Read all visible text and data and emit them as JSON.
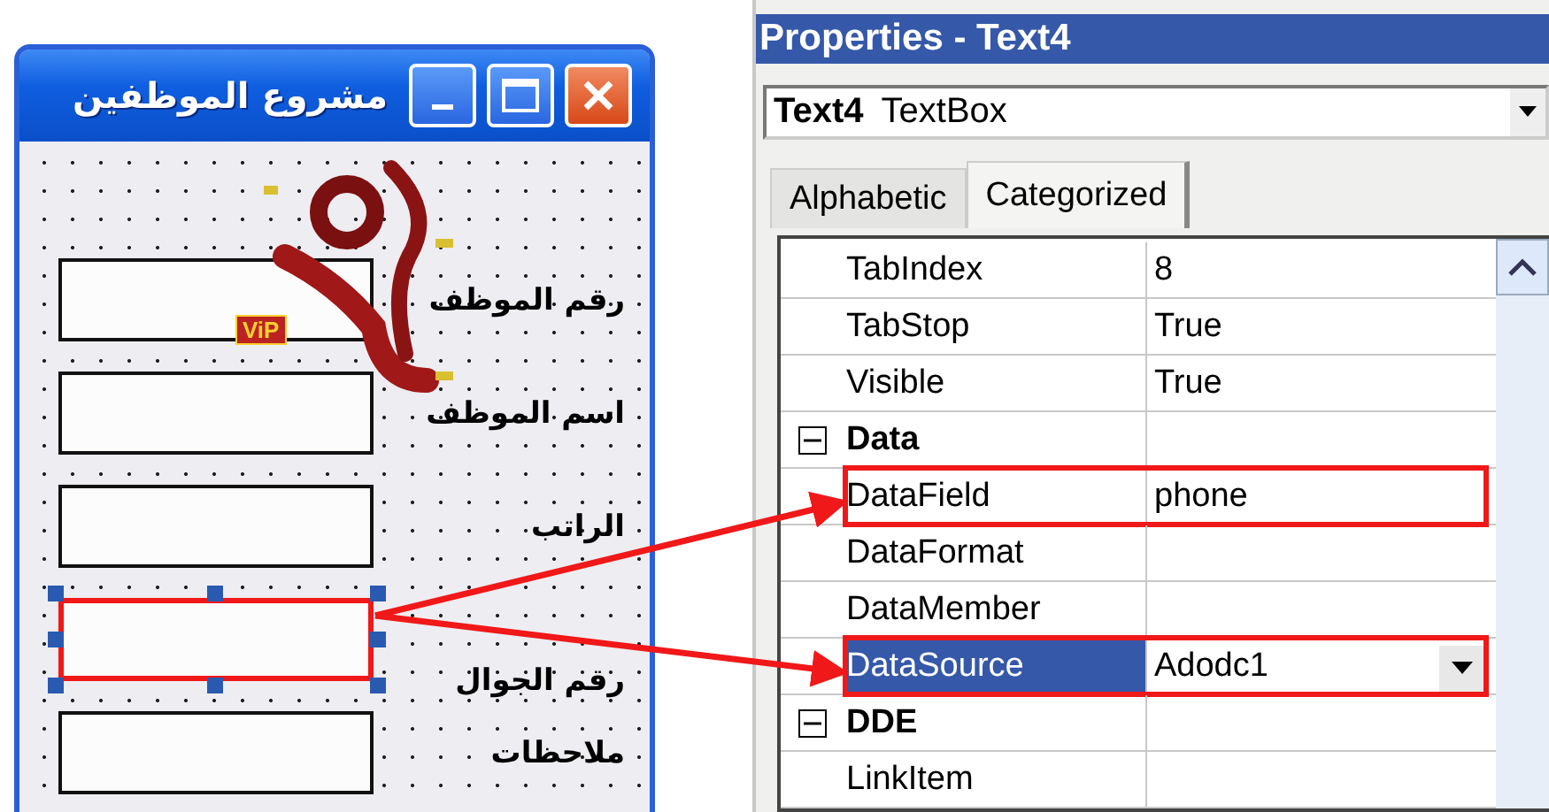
{
  "form": {
    "title": "مشروع الموظفين",
    "logo_badge": "ViP",
    "fields": [
      {
        "label": "رقم الموظف",
        "selected": false
      },
      {
        "label": "اسم الموظف",
        "selected": false
      },
      {
        "label": "الراتب",
        "selected": false
      },
      {
        "label": "رقم الجوال",
        "selected": true
      },
      {
        "label": "ملاحظات",
        "selected": false
      }
    ]
  },
  "properties": {
    "title": "Properties - Text4",
    "object_name": "Text4",
    "object_type": "TextBox",
    "tabs": [
      {
        "label": "Alphabetic",
        "selected": false
      },
      {
        "label": "Categorized",
        "selected": true
      }
    ],
    "rows": [
      {
        "kind": "property",
        "name": "TabIndex",
        "value": "8",
        "selected": false,
        "highlighted": false
      },
      {
        "kind": "property",
        "name": "TabStop",
        "value": "True",
        "selected": false,
        "highlighted": false
      },
      {
        "kind": "property",
        "name": "Visible",
        "value": "True",
        "selected": false,
        "highlighted": false
      },
      {
        "kind": "category",
        "name": "Data",
        "expanded": true
      },
      {
        "kind": "property",
        "name": "DataField",
        "value": "phone",
        "selected": false,
        "highlighted": true
      },
      {
        "kind": "property",
        "name": "DataFormat",
        "selected": false,
        "highlighted": false
      },
      {
        "kind": "property",
        "name": "DataMember",
        "selected": false,
        "highlighted": false
      },
      {
        "kind": "property",
        "name": "DataSource",
        "value": "Adodc1",
        "selected": true,
        "highlighted": true
      },
      {
        "kind": "category",
        "name": "DDE",
        "expanded": true
      },
      {
        "kind": "property",
        "name": "LinkItem",
        "selected": false,
        "highlighted": false
      }
    ]
  }
}
